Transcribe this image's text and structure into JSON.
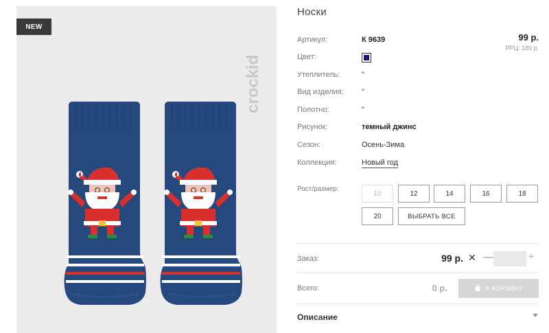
{
  "product": {
    "badge": "NEW",
    "brand": "crockid",
    "title": "Носки"
  },
  "specs": {
    "article_label": "Артикул:",
    "article_value": "К 9639",
    "color_label": "Цвет:",
    "color_hex": "#1a1775",
    "insulation_label": "Утеплитель:",
    "insulation_value": "\"",
    "type_label": "Вид изделия:",
    "type_value": "\"",
    "fabric_label": "Полотно:",
    "fabric_value": "\"",
    "pattern_label": "Рисунок:",
    "pattern_value": "темный джинс",
    "season_label": "Сезон:",
    "season_value": "Осень-Зима",
    "collection_label": "Коллекция:",
    "collection_value": "Новый год"
  },
  "price": {
    "value": "99 р.",
    "rrp": "РРЦ: 189 р."
  },
  "sizes": {
    "label": "Рост/размер:",
    "options": [
      "10",
      "12",
      "14",
      "16",
      "18",
      "20"
    ],
    "select_all": "ВЫБРАТЬ ВСЕ"
  },
  "order": {
    "label": "Заказ:",
    "price": "99 р.",
    "times": "✕",
    "minus": "—",
    "plus": "+",
    "quantity": ""
  },
  "total": {
    "label": "Всего:",
    "value": "0 р.",
    "cart_button": "В КОРЗИНУ"
  },
  "description": {
    "title": "Описание"
  }
}
